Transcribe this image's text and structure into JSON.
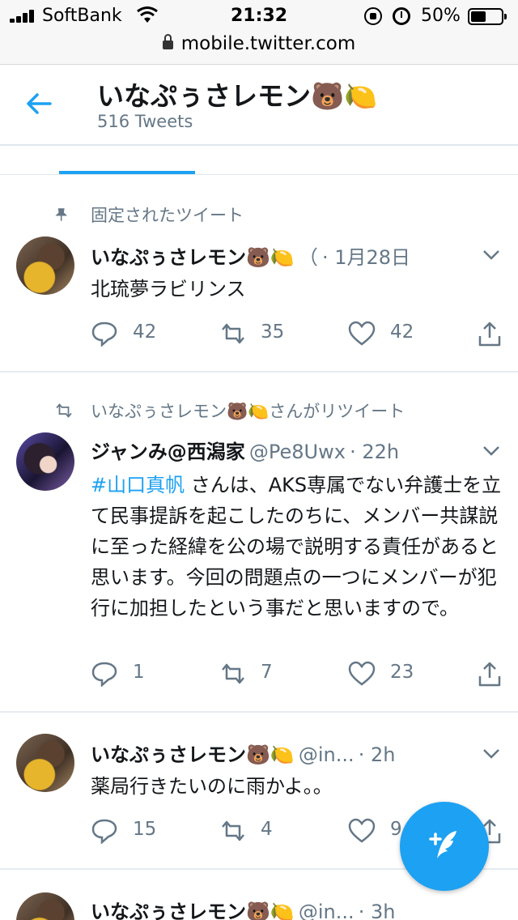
{
  "status_bar": {
    "carrier": "SoftBank",
    "time": "21:32",
    "battery": "50%",
    "battery_level": 0.5
  },
  "browser": {
    "url": "mobile.twitter.com"
  },
  "profile": {
    "name": "いなぷぅさレモン🐻🍋",
    "tweet_count": "516 Tweets"
  },
  "tweets": [
    {
      "social_context": "固定されたツイート",
      "author": "いなぷぅさレモン🐻🍋",
      "handle": "（",
      "time": "· 1月28日",
      "text": "北琉夢ラビリンス",
      "replies": "42",
      "retweets": "35",
      "likes": "42"
    },
    {
      "social_context": "いなぷぅさレモン🐻🍋さんがリツイート",
      "author": "ジャンみ@西潟家",
      "handle": "@Pe8Uwx",
      "time": "· 22h",
      "hashtag": "#山口真帆",
      "text": " さんは、AKS専属でない弁護士を立て民事提訴を起こしたのちに、メンバー共謀説に至った経緯を公の場で説明する責任があると思います。今回の問題点の一つにメンバーが犯行に加担したという事だと思いますので。",
      "replies": "1",
      "retweets": "7",
      "likes": "23"
    },
    {
      "author": "いなぷぅさレモン🐻🍋",
      "handle": "@in...",
      "time": "· 2h",
      "text": "薬局行きたいのに雨かよ。。",
      "replies": "15",
      "retweets": "4",
      "likes": "9"
    },
    {
      "author": "いなぷぅさレモン🐻🍋",
      "handle": "@in...",
      "time": "· 3h"
    }
  ],
  "colors": {
    "accent": "#1da1f2",
    "secondary_text": "#657786",
    "divider": "#e6ecf0"
  },
  "icons": [
    "back-arrow-icon",
    "pin-icon",
    "retweet-icon",
    "reply-icon",
    "heart-icon",
    "share-icon",
    "chevron-down-icon",
    "compose-tweet-icon"
  ]
}
